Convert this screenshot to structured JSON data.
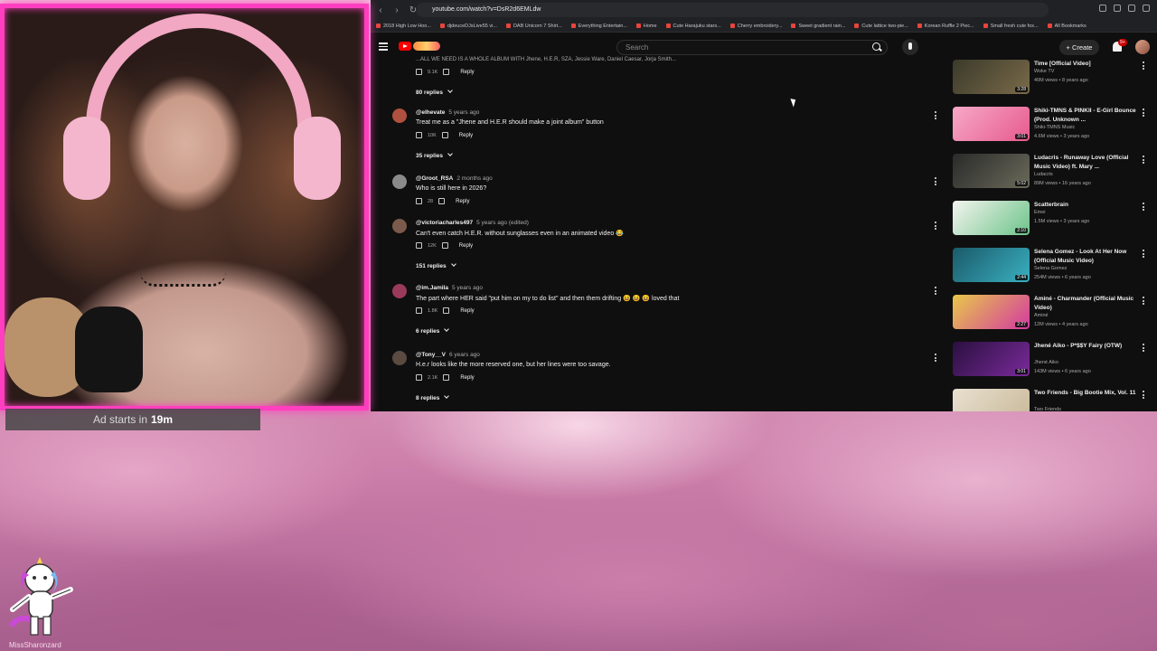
{
  "browser": {
    "url": "youtube.com/watch?v=DsR2d6EMLdw",
    "bookmarks": [
      "2018 High Low Hoo...",
      "djdeuceDJsLive55 vi...",
      "DAB Unicorn 7 Shirt...",
      "Everything Entertain...",
      "Home",
      "Cute Harajuku stars...",
      "Cherry embroidery...",
      "Sweet gradient rain...",
      "Cute lattice two-pie...",
      "Korean Ruffle 2 Piec...",
      "Small fresh cute fox...",
      "All Bookmarks"
    ]
  },
  "youtube": {
    "search_placeholder": "Search",
    "create_label": "+ Create",
    "notification_count": "9+"
  },
  "comments": {
    "partial_text": "...ALL WE NEED IS A WHOLE ALBUM WITH Jhene, H.E.R, SZA, Jessie Ware, Daniel Caesar, Jorja Smith...",
    "partial_likes": "9.1K",
    "partial_replies": "80 replies",
    "items": [
      {
        "author": "@elhevate",
        "time": "5 years ago",
        "text": "Treat me as a \"Jhene and H.E.R should make a joint album\" button",
        "likes": "10K",
        "replies": "35 replies",
        "avatar_color": "#b0503f"
      },
      {
        "author": "@Groot_RSA",
        "time": "2 months ago",
        "text": "Who is still here in 2026?",
        "likes": "28",
        "replies": "",
        "avatar_color": "#8a8a8a"
      },
      {
        "author": "@victoriacharles497",
        "time": "5 years ago (edited)",
        "text": "Can't even catch H.E.R. without sunglasses even in an animated video 😂",
        "likes": "12K",
        "replies": "151 replies",
        "avatar_color": "#7a5a4a"
      },
      {
        "author": "@im.Jamila",
        "time": "5 years ago",
        "text": "The part where HER said  \"put him on my to do list\" and then them drifting 😆 😆 😆 loved that",
        "likes": "1.8K",
        "replies": "6 replies",
        "avatar_color": "#9a3a5a"
      },
      {
        "author": "@Tony__V",
        "time": "6 years ago",
        "text": "H.e.r looks like the more reserved one, but her lines were too savage.",
        "likes": "2.1K",
        "replies": "8 replies",
        "avatar_color": "#5a4a40"
      }
    ],
    "reply_label": "Reply"
  },
  "sidebar": {
    "videos": [
      {
        "title": "Time [Official Video]",
        "channel": "Woke TV",
        "meta": "40M views • 8 years ago",
        "duration": "3:28",
        "thumb": [
          "#3a3a2a",
          "#7a6a4a"
        ]
      },
      {
        "title": "Shiki-TMNS & PINKII - E-Girl Bounce (Prod. Unknown ...",
        "channel": "Shiki-TMNS Music",
        "meta": "4.6M views • 3 years ago",
        "duration": "3:01",
        "thumb": [
          "#f7a8c8",
          "#e65a8c"
        ]
      },
      {
        "title": "Ludacris - Runaway Love (Official Music Video) ft. Mary ...",
        "channel": "Ludacris",
        "meta": "89M views • 16 years ago",
        "duration": "5:02",
        "thumb": [
          "#2a2a2a",
          "#6a6a5a"
        ]
      },
      {
        "title": "Scatterbrain",
        "channel": "Emei",
        "meta": "1.5M views • 3 years ago",
        "duration": "2:10",
        "thumb": [
          "#f4f4ee",
          "#6cc48a"
        ]
      },
      {
        "title": "Selena Gomez - Look At Her Now (Official Music Video)",
        "channel": "Selena Gomez",
        "meta": "254M views • 6 years ago",
        "duration": "2:44",
        "thumb": [
          "#1a5a6a",
          "#3ab0c0"
        ]
      },
      {
        "title": "Aminé - Charmander (Official Music Video)",
        "channel": "Aminé",
        "meta": "12M views • 4 years ago",
        "duration": "2:27",
        "thumb": [
          "#e8c84a",
          "#d43aa0"
        ]
      },
      {
        "title": "Jhené Aiko - P*$$Y Fairy (OTW)",
        "channel": "Jhené Aiko",
        "meta": "143M views • 6 years ago",
        "duration": "3:01",
        "thumb": [
          "#2a1040",
          "#7a2a9a"
        ]
      },
      {
        "title": "Two Friends - Big Bootie Mix, Vol. 11",
        "channel": "Two Friends",
        "meta": "",
        "duration": "",
        "thumb": [
          "#e8e0d0",
          "#c8b898"
        ]
      }
    ]
  },
  "overlay": {
    "ad_label": "Ad starts in",
    "ad_time": "19m",
    "streamer_name": "MissSharonzard"
  }
}
